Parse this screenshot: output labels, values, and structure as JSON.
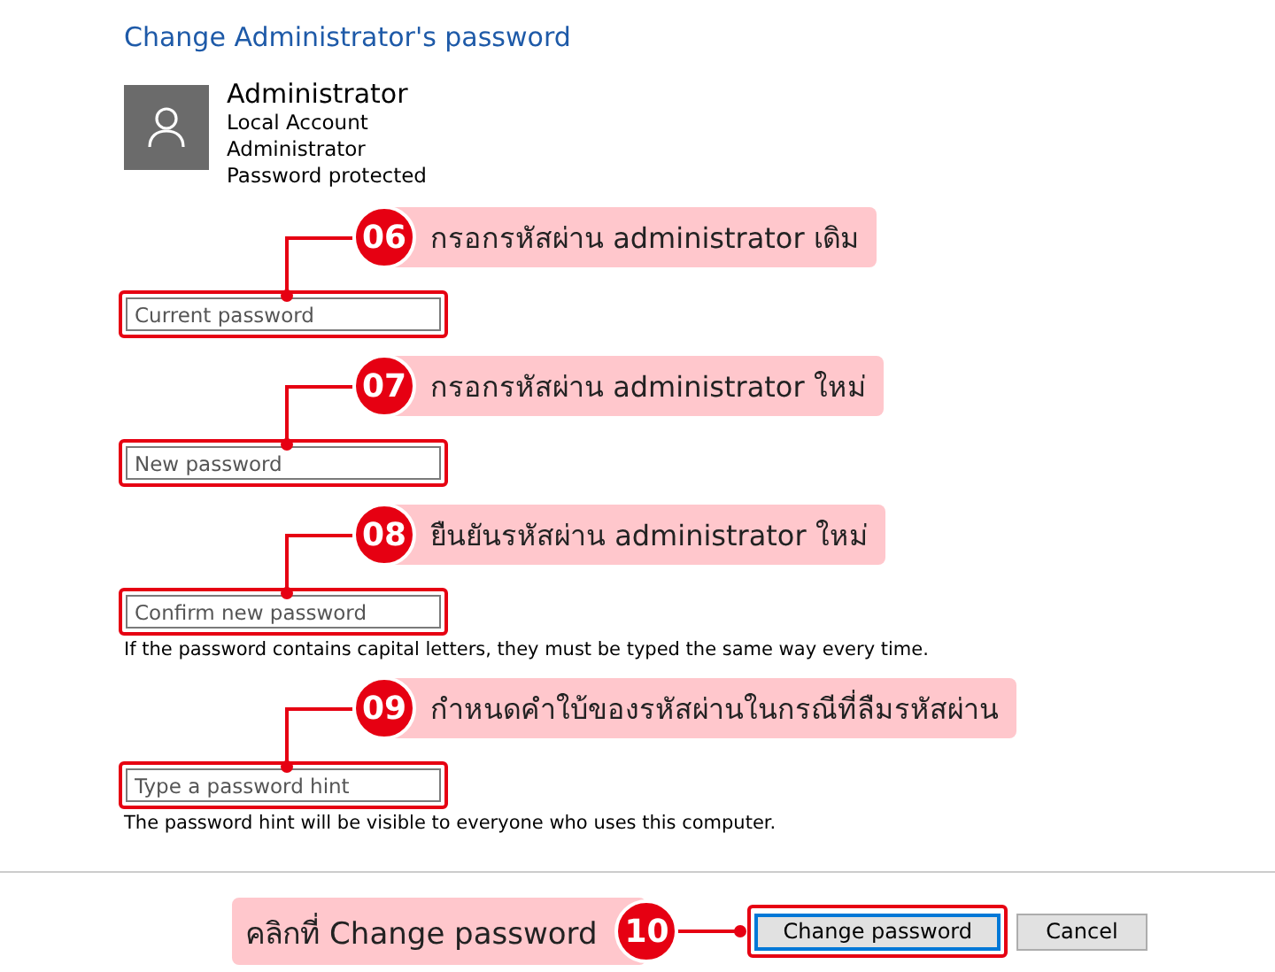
{
  "title": "Change Administrator's password",
  "account": {
    "name": "Administrator",
    "details": [
      "Local Account",
      "Administrator",
      "Password protected"
    ]
  },
  "steps": [
    {
      "number": "06",
      "instruction": "กรอกรหัสผ่าน administrator เดิม",
      "placeholder": "Current password"
    },
    {
      "number": "07",
      "instruction": "กรอกรหัสผ่าน administrator ใหม่",
      "placeholder": "New password"
    },
    {
      "number": "08",
      "instruction": "ยืนยันรหัสผ่าน administrator ใหม่",
      "placeholder": "Confirm new password",
      "note": "If the password contains capital letters, they must be typed the same way every time."
    },
    {
      "number": "09",
      "instruction": "กำหนดคำใบ้ของรหัสผ่านในกรณีที่ลืมรหัสผ่าน",
      "placeholder": "Type a password hint",
      "note": "The password hint will be visible to everyone who uses this computer."
    }
  ],
  "footer": {
    "callout": {
      "number": "10",
      "instruction": "คลิกที่ Change password"
    },
    "buttons": [
      {
        "label": "Change password",
        "default": true
      },
      {
        "label": "Cancel",
        "default": false
      }
    ]
  }
}
